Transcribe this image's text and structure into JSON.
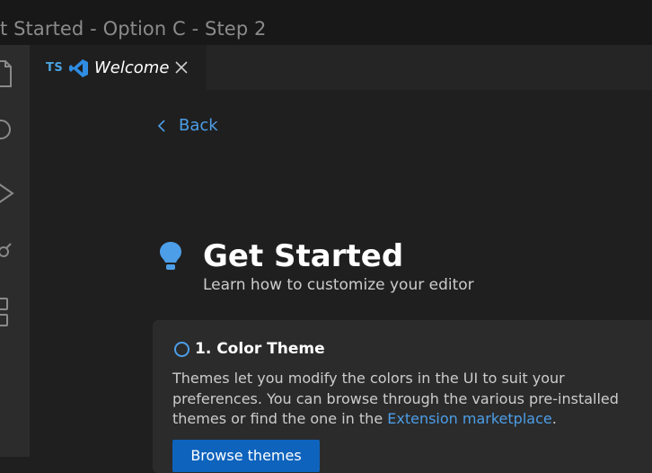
{
  "window": {
    "title": "t Started - Option C - Step 2"
  },
  "activity_bar": {
    "icons": [
      "explorer-icon",
      "search-icon",
      "run-debug-icon",
      "source-control-icon",
      "extensions-icon"
    ]
  },
  "tabs": [
    {
      "type_badge": "TS",
      "icon": "vscode-logo-icon",
      "label": "Welcome",
      "close_icon": "close-icon"
    }
  ],
  "page": {
    "back_label": "Back",
    "title": "Get Started",
    "subtitle": "Learn how to customize your editor",
    "step": {
      "title": "1. Color Theme",
      "description_before": "Themes let you modify the colors in the UI to suit your preferences. You can browse through the various pre-installed themes or find the one in the ",
      "link_text": "Extension marketplace",
      "description_after": ".",
      "button_label": "Browse themes"
    }
  },
  "colors": {
    "accent": "#4c9ee8",
    "button_bg": "#0e63bd",
    "card_bg": "#2b2b2b",
    "editor_bg": "#1f1f1f"
  }
}
